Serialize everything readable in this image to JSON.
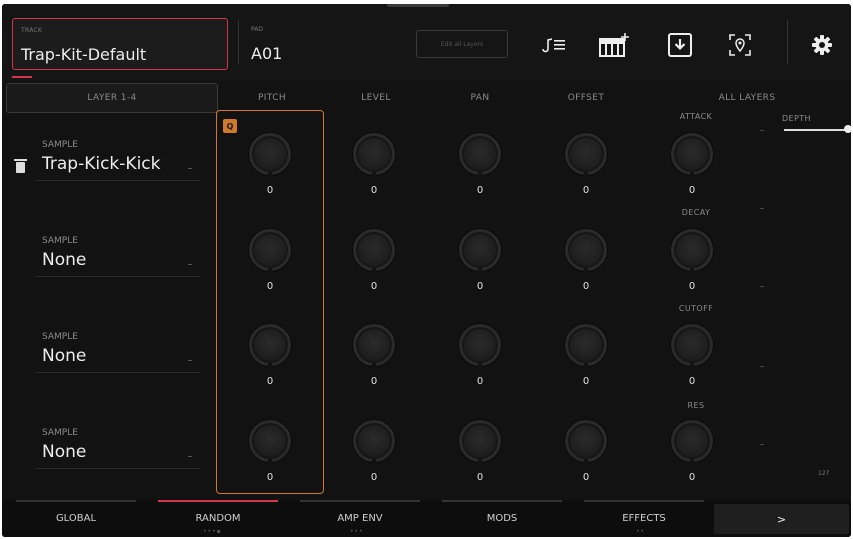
{
  "header": {
    "track_caption": "TRACK",
    "track_name": "Trap-Kit-Default",
    "pad_caption": "PAD",
    "pad_name": "A01",
    "edit_layers_label": "Edit all Layers",
    "icons": [
      "note-list-icon",
      "keyboard-plus-icon",
      "download-icon",
      "locate-icon",
      "settings-gear-icon"
    ]
  },
  "columns": {
    "layer_tab": "LAYER 1-4",
    "pitch": "PITCH",
    "level": "LEVEL",
    "pan": "PAN",
    "offset": "OFFSET",
    "all_layers": "ALL LAYERS",
    "depth": "DEPTH"
  },
  "pitch_badge": "Q",
  "samples": [
    {
      "caption": "SAMPLE",
      "name": "Trap-Kick-Kick",
      "pitch": "0",
      "level": "0",
      "pan": "0",
      "offset": "0"
    },
    {
      "caption": "SAMPLE",
      "name": "None",
      "pitch": "0",
      "level": "0",
      "pan": "0",
      "offset": "0"
    },
    {
      "caption": "SAMPLE",
      "name": "None",
      "pitch": "0",
      "level": "0",
      "pan": "0",
      "offset": "0"
    },
    {
      "caption": "SAMPLE",
      "name": "None",
      "pitch": "0",
      "level": "0",
      "pan": "0",
      "offset": "0"
    }
  ],
  "all_layers": [
    {
      "label": "ATTACK",
      "value": "0"
    },
    {
      "label": "DECAY",
      "value": "0"
    },
    {
      "label": "CUTOFF",
      "value": "0"
    },
    {
      "label": "RES",
      "value": "0"
    }
  ],
  "depth_value": "127",
  "bottom_tabs": [
    {
      "label": "GLOBAL"
    },
    {
      "label": "RANDOM"
    },
    {
      "label": "AMP ENV"
    },
    {
      "label": "MODS"
    },
    {
      "label": "EFFECTS"
    }
  ],
  "more_label": ">",
  "colors": {
    "accent_red": "#d2344b",
    "accent_orange": "#d0792a",
    "background": "#121212"
  }
}
